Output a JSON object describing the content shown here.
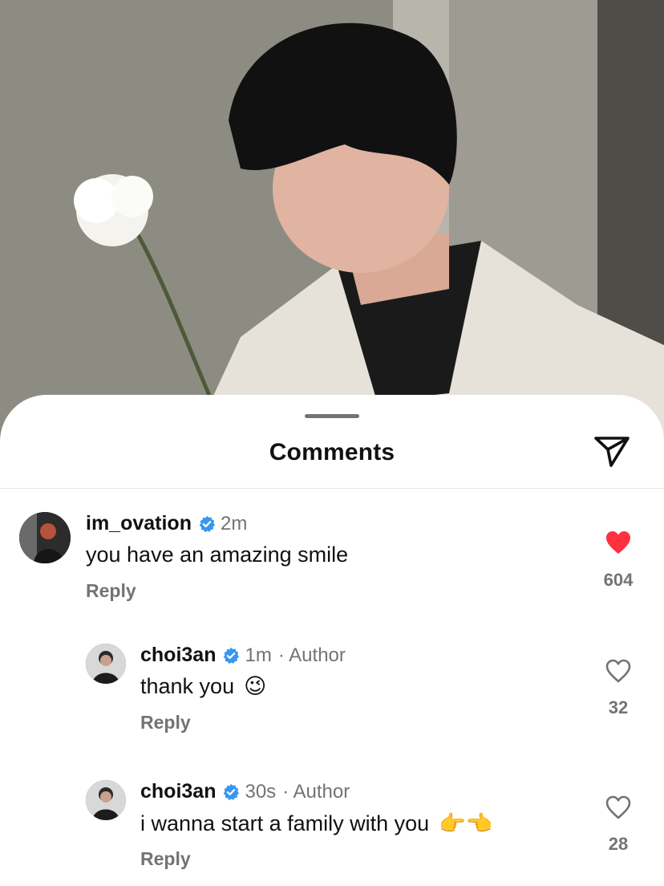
{
  "sheet": {
    "title": "Comments",
    "share_icon": "send-icon"
  },
  "comments": [
    {
      "username": "im_ovation",
      "verified": true,
      "time": "2m",
      "author_tag": "",
      "text": "you have an amazing smile",
      "emoji": "",
      "reply_label": "Reply",
      "likes": "604",
      "liked": true,
      "like_color": "#ff3040"
    },
    {
      "username": "choi3an",
      "verified": true,
      "time": "1m",
      "author_tag": "· Author",
      "text": "thank you",
      "emoji": "😉",
      "reply_label": "Reply",
      "likes": "32",
      "liked": false
    },
    {
      "username": "choi3an",
      "verified": true,
      "time": "30s",
      "author_tag": "· Author",
      "text": "i wanna start a family with you",
      "emoji": "👉👈",
      "reply_label": "Reply",
      "likes": "28",
      "liked": false
    }
  ],
  "colors": {
    "verified_badge": "#3897f0",
    "muted_text": "#737373"
  }
}
